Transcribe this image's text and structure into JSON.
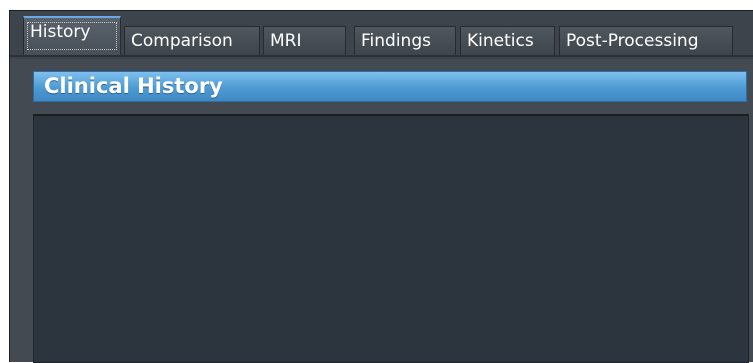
{
  "tabs": [
    {
      "label": "History",
      "active": true
    },
    {
      "label": "Comparison",
      "active": false
    },
    {
      "label": "MRI",
      "active": false
    },
    {
      "label": "Findings",
      "active": false
    },
    {
      "label": "Kinetics",
      "active": false
    },
    {
      "label": "Post-Processing",
      "active": false
    }
  ],
  "panel": {
    "title": "Clinical History"
  },
  "colors": {
    "window_bg": "#434a52",
    "header_accent": "#4d9ad4",
    "content_bg": "#2c343e",
    "text": "#ffffff"
  }
}
